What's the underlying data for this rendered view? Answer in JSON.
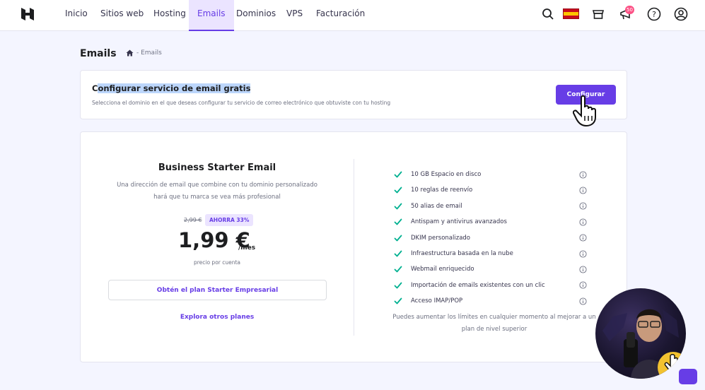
{
  "nav": {
    "items": [
      {
        "label": "Inicio",
        "active": false
      },
      {
        "label": "Sitios web",
        "active": false
      },
      {
        "label": "Hosting",
        "active": false
      },
      {
        "label": "Emails",
        "active": true
      },
      {
        "label": "Dominios",
        "active": false
      },
      {
        "label": "VPS",
        "active": false
      },
      {
        "label": "Facturación",
        "active": false
      }
    ],
    "icons": [
      "search-icon",
      "spain-flag",
      "store-icon",
      "megaphone-icon",
      "help-icon",
      "account-icon"
    ],
    "notifications_count": "50"
  },
  "header": {
    "title": "Emails",
    "breadcrumb": "- Emails"
  },
  "setup": {
    "title_plain": "C",
    "title_highlighted": "onfigurar servicio de email gratis",
    "subtitle": "Selecciona el dominio en el que deseas configurar tu servicio de correo electrónico que obtuviste con tu hosting",
    "button_label": "Configurar"
  },
  "plan": {
    "name": "Business Starter Email",
    "description_lines": [
      "Una dirección de email que combine con tu dominio personalizado",
      "hará que tu marca se vea más profesional"
    ],
    "old_price": "2,99 €",
    "discount": "AHORRA 33%",
    "price": "1,99 €",
    "period": "/mes",
    "price_note": "precio por cuenta",
    "get_button": "Obtén el plan Starter Empresarial",
    "explore_link": "Explora otros planes",
    "features": [
      "10 GB Espacio en disco",
      "10 reglas de reenvío",
      "50 alias de email",
      "Antispam y antivirus avanzados",
      "DKIM personalizado",
      "Infraestructura basada en la nube",
      "Webmail enriquecido",
      "Importación de emails existentes con un clic",
      "Acceso IMAP/POP"
    ],
    "footnote_lines": [
      "Puedes aumentar los límites en cualquier momento al mejorar a un",
      "plan de nivel superior"
    ]
  },
  "colors": {
    "brand": "#673de6",
    "check": "#00b090",
    "badge": "#fc5185"
  }
}
